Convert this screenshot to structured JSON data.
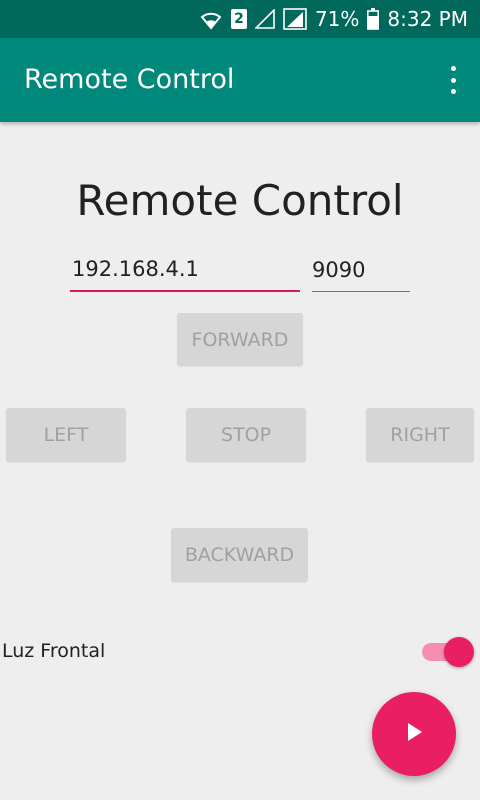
{
  "status_bar": {
    "sim_label": "2",
    "battery": "71%",
    "time": "8:32 PM",
    "icons": [
      "wifi-icon",
      "sim-icon",
      "signal-icon",
      "signal-icon",
      "battery-icon"
    ]
  },
  "toolbar": {
    "title": "Remote Control",
    "menu_icon": "overflow-menu-icon"
  },
  "main": {
    "heading": "Remote Control",
    "ip_field": {
      "value": "192.168.4.1"
    },
    "port_field": {
      "value": "9090"
    },
    "buttons": {
      "forward": "FORWARD",
      "left": "LEFT",
      "stop": "STOP",
      "right": "RIGHT",
      "backward": "BACKWARD"
    },
    "switch": {
      "label": "Luz Frontal",
      "on": true
    },
    "fab_icon": "play-icon"
  },
  "colors": {
    "status_bar": "#00695c",
    "toolbar": "#00897b",
    "accent": "#e91e63",
    "background": "#eeeeee",
    "button_bg": "#d6d6d6",
    "button_text": "#a0a0a0"
  }
}
